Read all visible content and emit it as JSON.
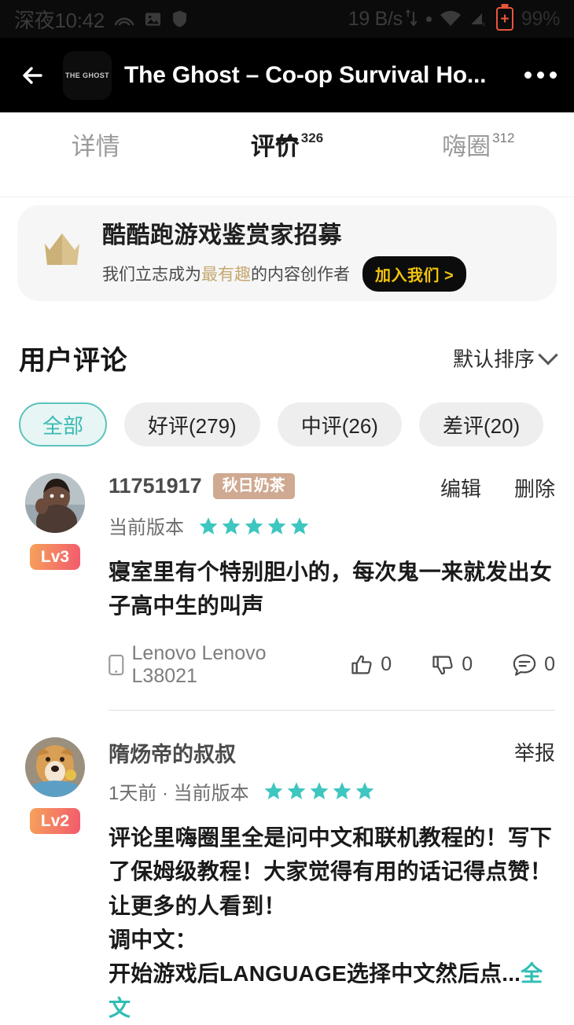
{
  "statusbar": {
    "time": "深夜10:42",
    "icons_left": [
      "signal-arc-icon",
      "photo-icon",
      "shield-icon"
    ],
    "network_speed": "19 B/s",
    "speed_arrows": "↑↓",
    "dot": "•",
    "wifi_icon": "wifi-icon",
    "cell_icon": "cell-signal-off-icon",
    "battery_label": "+",
    "battery_percent": "99%",
    "battery_color": "#e8563a"
  },
  "appbar": {
    "back": "back-arrow-icon",
    "app_icon_text": "THE GHOST",
    "title": "The Ghost – Co-op Survival Ho...",
    "more": "more-options-icon"
  },
  "tabs": [
    {
      "label": "详情",
      "count": "",
      "active": false
    },
    {
      "label": "评价",
      "count": "326",
      "active": true
    },
    {
      "label": "嗨圈",
      "count": "312",
      "active": false
    }
  ],
  "promo": {
    "icon": "crown-icon",
    "title": "酷酷跑游戏鉴赏家招募",
    "sub_before": "我们立志成为",
    "sub_highlight": "最有趣",
    "sub_after": "的内容创作者",
    "button": "加入我们 >",
    "button_bg": "#0c0c0c",
    "button_fg": "#f2c40d",
    "highlight_color": "#c6a871"
  },
  "section": {
    "title": "用户评论",
    "sort_label": "默认排序",
    "sort_icon": "chevron-down-icon"
  },
  "filters": [
    {
      "label": "全部",
      "active": true
    },
    {
      "label": "好评(279)",
      "active": false
    },
    {
      "label": "中评(26)",
      "active": false
    },
    {
      "label": "差评(20)",
      "active": false
    }
  ],
  "accent": {
    "teal": "#3cb9b4",
    "star": "#3ec6c0",
    "level_gradient_from": "#f6a25b",
    "level_gradient_to": "#f25a6d",
    "tag_bg": "#cfa991"
  },
  "reviews": [
    {
      "avatar": "user-avatar-man",
      "level": "Lv3",
      "name": "11751917",
      "tag": "秋日奶茶",
      "meta": "当前版本",
      "stars": 5,
      "actions": [
        "编辑",
        "删除"
      ],
      "body": "寝室里有个特别胆小的，每次鬼一来就发出女子高中生的叫声",
      "more_label": "",
      "device": "Lenovo Lenovo L38021",
      "likes": "0",
      "dislikes": "0",
      "comments": "0"
    },
    {
      "avatar": "user-avatar-dog",
      "level": "Lv2",
      "name": "隋炀帝的叔叔",
      "tag": "",
      "meta": "1天前 · 当前版本",
      "stars": 5,
      "actions": [
        "举报"
      ],
      "body": "评论里嗨圈里全是问中文和联机教程的！写下了保姆级教程！大家觉得有用的话记得点赞！让更多的人看到！\n调中文：\n开始游戏后LANGUAGE选择中文然后点...",
      "more_label": "全文",
      "device": "",
      "likes": "",
      "dislikes": "",
      "comments": ""
    }
  ]
}
